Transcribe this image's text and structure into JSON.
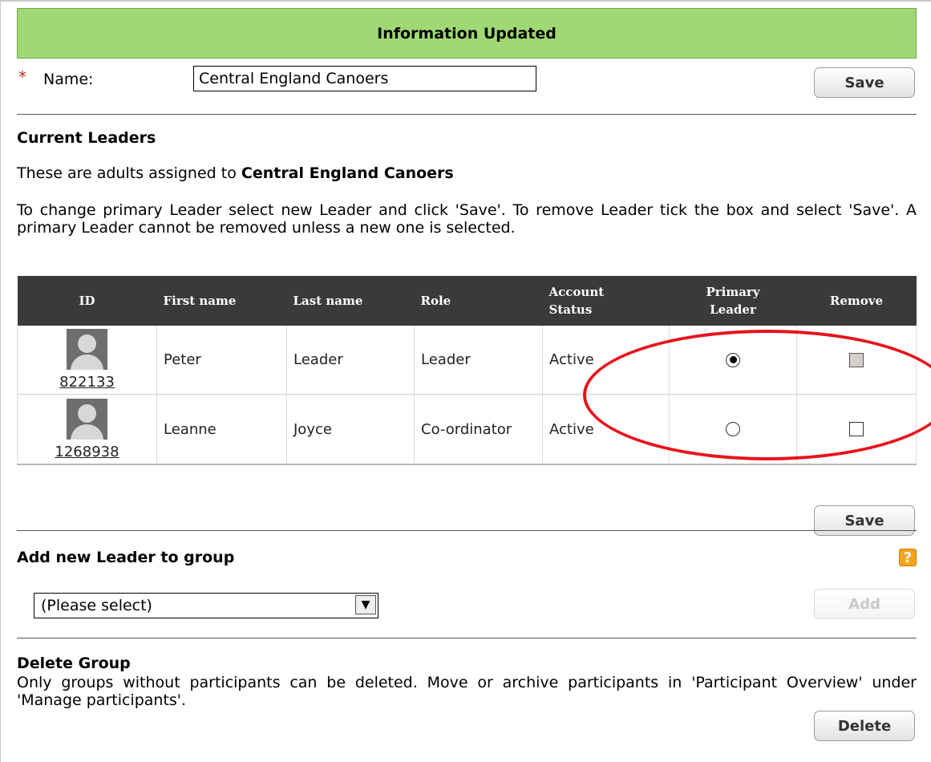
{
  "banner": {
    "text": "Information Updated"
  },
  "name_field": {
    "required_marker": "*",
    "label": "Name:",
    "value": "Central England Canoers"
  },
  "buttons": {
    "save_top": "Save",
    "save_table": "Save",
    "add": "Add",
    "delete": "Delete"
  },
  "leaders_section": {
    "heading": "Current Leaders",
    "assigned_prefix": "These are adults assigned to ",
    "group_name": "Central England Canoers",
    "instructions": "To change primary Leader select new Leader and click 'Save'. To remove Leader tick the box and select 'Save'. A primary Leader cannot be removed unless a new one is selected."
  },
  "table": {
    "headers": {
      "id": "ID",
      "first_name": "First name",
      "last_name": "Last name",
      "role": "Role",
      "account_status_1": "Account",
      "account_status_2": "Status",
      "primary_leader_1": "Primary",
      "primary_leader_2": "Leader",
      "remove": "Remove"
    },
    "rows": [
      {
        "id": "822133",
        "first_name": "Peter",
        "last_name": "Leader",
        "role": "Leader",
        "status": "Active",
        "primary": true,
        "remove": false
      },
      {
        "id": "1268938",
        "first_name": "Leanne",
        "last_name": "Joyce",
        "role": "Co-ordinator",
        "status": "Active",
        "primary": false,
        "remove": false
      }
    ]
  },
  "add_leader": {
    "heading": "Add new Leader to group",
    "help_icon": "?",
    "select_value": "(Please select)"
  },
  "delete_group": {
    "heading": "Delete Group",
    "text": "Only groups without participants can be deleted. Move or archive participants in 'Participant Overview' under 'Manage participants'."
  },
  "colors": {
    "banner": "#a0d973",
    "table_header": "#3a3a3a",
    "annotation": "#e8131c",
    "required": "#c0271c"
  }
}
